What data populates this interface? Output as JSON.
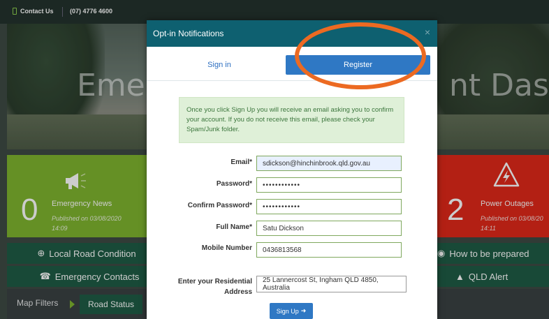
{
  "topbar": {
    "contact_label": "Contact Us",
    "phone": "(07) 4776 4600"
  },
  "hero": {
    "headline_left": "Emer",
    "headline_right": "nt Dash"
  },
  "tiles": {
    "news": {
      "count": "0",
      "label": "Emergency News",
      "published_line1": "Published on 03/08/2020",
      "published_line2": "14:09"
    },
    "power": {
      "count": "2",
      "label": "Power Outages",
      "published_line1": "Published on 03/08/20",
      "published_line2": "14:11"
    }
  },
  "links": {
    "local_road": "Local Road Condition",
    "emergency_contacts": "Emergency Contacts",
    "how_prepared": "How to be prepared",
    "qld_alert": "QLD Alert"
  },
  "map": {
    "filters_label": "Map Filters",
    "road_status": "Road Status"
  },
  "modal": {
    "title": "Opt-in Notifications",
    "close": "×",
    "tab_signin": "Sign in",
    "tab_register": "Register",
    "notice": "Once you click Sign Up you will receive an email asking you to confirm your account. If you do not receive this email, please check your Spam/Junk folder.",
    "fields": {
      "email_label": "Email*",
      "email_value": "sdickson@hinchinbrook.qld.gov.au",
      "password_label": "Password*",
      "password_value": "••••••••••••",
      "confirm_label": "Confirm Password*",
      "confirm_value": "••••••••••••",
      "fullname_label": "Full Name*",
      "fullname_value": "Satu Dickson",
      "mobile_label": "Mobile Number",
      "mobile_value": "0436813568",
      "address_label_1": "Enter your Residential",
      "address_label_2": "Address",
      "address_value": "25 Lannercost St, Ingham QLD 4850, Australia"
    },
    "signup_label": "Sign Up"
  },
  "colors": {
    "header": "#0e6070",
    "register_tab": "#2f78c4",
    "news_tile": "#7fb52f",
    "power_tile": "#e0291a",
    "annotation": "#ec6a22"
  }
}
